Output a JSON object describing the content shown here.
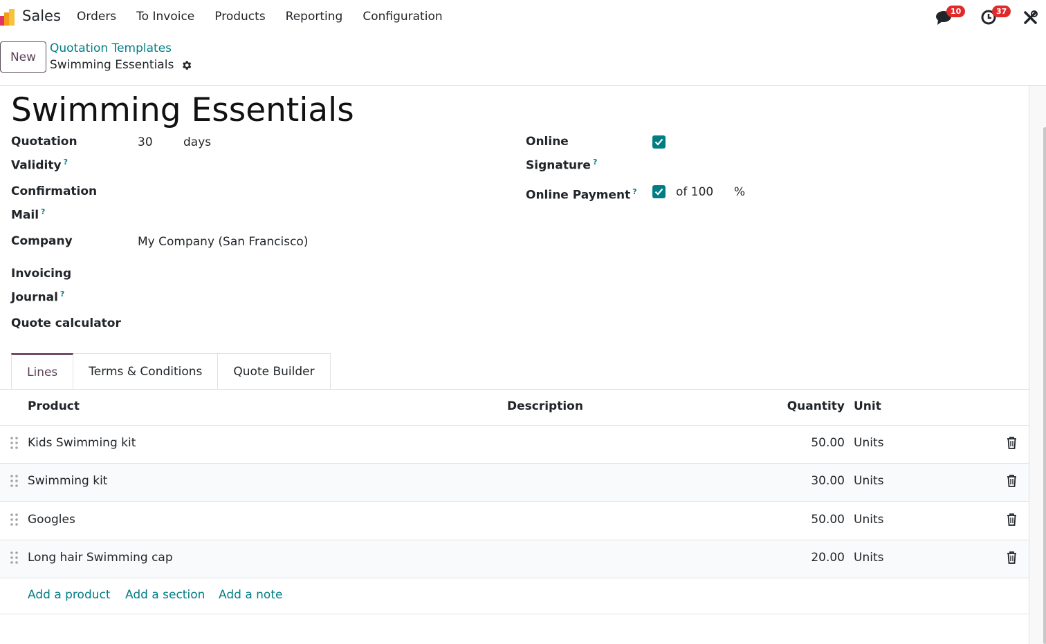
{
  "navbar": {
    "app_name": "Sales",
    "menu": [
      "Orders",
      "To Invoice",
      "Products",
      "Reporting",
      "Configuration"
    ],
    "messages_count": "10",
    "activities_count": "37"
  },
  "control_panel": {
    "new_label": "New",
    "breadcrumb_parent": "Quotation Templates",
    "breadcrumb_current": "Swimming Essentials"
  },
  "form": {
    "title": "Swimming Essentials",
    "validity_label_1": "Quotation",
    "validity_label_2": "Validity",
    "validity_value": "30",
    "validity_unit": "days",
    "confirmation_label_1": "Confirmation",
    "confirmation_label_2": "Mail",
    "company_label": "Company",
    "company_value": "My Company (San Francisco)",
    "journal_label_1": "Invoicing",
    "journal_label_2": "Journal",
    "quote_calculator_label": "Quote calculator",
    "signature_label_1": "Online",
    "signature_label_2": "Signature",
    "signature_checked": true,
    "payment_label": "Online Payment",
    "payment_checked": true,
    "payment_of": "of 100",
    "payment_percent": "%",
    "help_mark": "?"
  },
  "tabs": [
    {
      "label": "Lines",
      "active": true
    },
    {
      "label": "Terms & Conditions",
      "active": false
    },
    {
      "label": "Quote Builder",
      "active": false
    }
  ],
  "table": {
    "headers": {
      "product": "Product",
      "description": "Description",
      "quantity": "Quantity",
      "unit": "Unit"
    },
    "rows": [
      {
        "product": "Kids Swimming kit",
        "quantity": "50.00",
        "unit": "Units"
      },
      {
        "product": "Swimming kit",
        "quantity": "30.00",
        "unit": "Units"
      },
      {
        "product": "Googles",
        "quantity": "50.00",
        "unit": "Units"
      },
      {
        "product": "Long hair Swimming cap",
        "quantity": "20.00",
        "unit": "Units"
      }
    ],
    "add_product": "Add a product",
    "add_section": "Add a section",
    "add_note": "Add a note"
  },
  "colors": {
    "accent": "#017e84",
    "brand": "#714b67",
    "badge": "#e02b2b"
  }
}
